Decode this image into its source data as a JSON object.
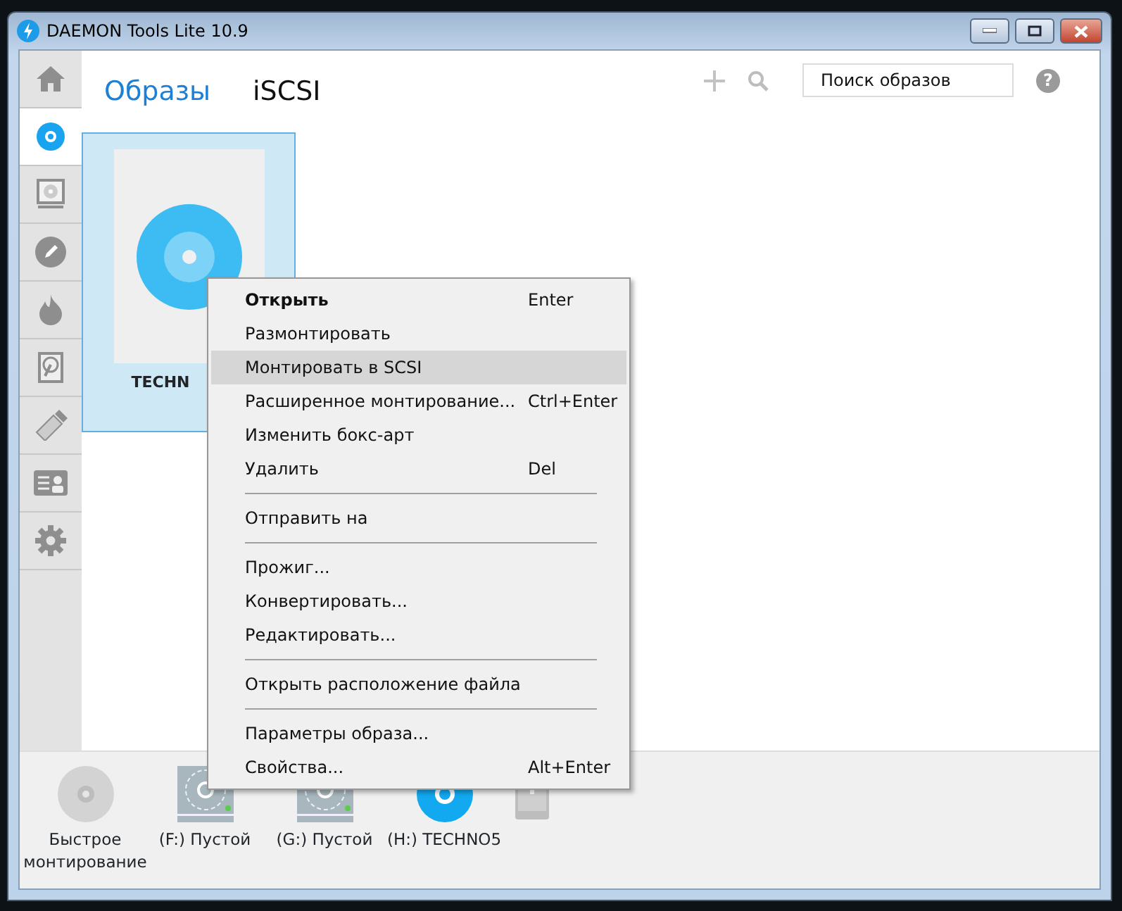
{
  "window": {
    "title": "DAEMON Tools Lite 10.9"
  },
  "sidebar": {
    "items": [
      {
        "kind": "home",
        "selected": false
      },
      {
        "kind": "images",
        "selected": true
      },
      {
        "kind": "virtual-drive",
        "selected": false
      },
      {
        "kind": "edit",
        "selected": false
      },
      {
        "kind": "burn",
        "selected": false
      },
      {
        "kind": "hard-disk",
        "selected": false
      },
      {
        "kind": "usb",
        "selected": false
      },
      {
        "kind": "contacts",
        "selected": false
      },
      {
        "kind": "settings",
        "selected": false
      }
    ]
  },
  "tabs": [
    {
      "label": "Образы",
      "selected": true
    },
    {
      "label": "iSCSI",
      "selected": false
    }
  ],
  "search": {
    "placeholder": "Поиск образов"
  },
  "help": {
    "label": "?"
  },
  "images": [
    {
      "label": "TECHN",
      "selected": true
    }
  ],
  "context_menu": [
    {
      "kind": "item",
      "label": "Открыть",
      "shortcut": "Enter",
      "default": true,
      "selected": false
    },
    {
      "kind": "item",
      "label": "Размонтировать",
      "default": false,
      "selected": false
    },
    {
      "kind": "item",
      "label": "Монтировать в SCSI",
      "default": false,
      "selected": true
    },
    {
      "kind": "item",
      "label": "Расширенное монтирование...",
      "shortcut": "Ctrl+Enter",
      "default": false,
      "selected": false
    },
    {
      "kind": "item",
      "label": "Изменить бокс-арт",
      "default": false,
      "selected": false
    },
    {
      "kind": "item",
      "label": "Удалить",
      "shortcut": "Del",
      "default": false,
      "selected": false
    },
    {
      "kind": "separator"
    },
    {
      "kind": "item",
      "label": "Отправить на",
      "default": false,
      "selected": false
    },
    {
      "kind": "separator"
    },
    {
      "kind": "item",
      "label": "Прожиг...",
      "default": false,
      "selected": false
    },
    {
      "kind": "item",
      "label": "Конвертировать...",
      "default": false,
      "selected": false
    },
    {
      "kind": "item",
      "label": "Редактировать...",
      "default": false,
      "selected": false
    },
    {
      "kind": "separator"
    },
    {
      "kind": "item",
      "label": "Открыть расположение файла",
      "default": false,
      "selected": false
    },
    {
      "kind": "separator"
    },
    {
      "kind": "item",
      "label": "Параметры образа...",
      "default": false,
      "selected": false
    },
    {
      "kind": "item",
      "label": "Свойства...",
      "shortcut": "Alt+Enter",
      "default": false,
      "selected": false
    }
  ],
  "drives": [
    {
      "kind": "quick-mount",
      "label": "Быстрое монтирование"
    },
    {
      "kind": "empty-drive",
      "label": "(F:) Пустой"
    },
    {
      "kind": "empty-drive",
      "label": "(G:) Пустой"
    },
    {
      "kind": "mounted-drive",
      "label": "(H:) TECHNO5"
    },
    {
      "kind": "add-device"
    }
  ]
}
